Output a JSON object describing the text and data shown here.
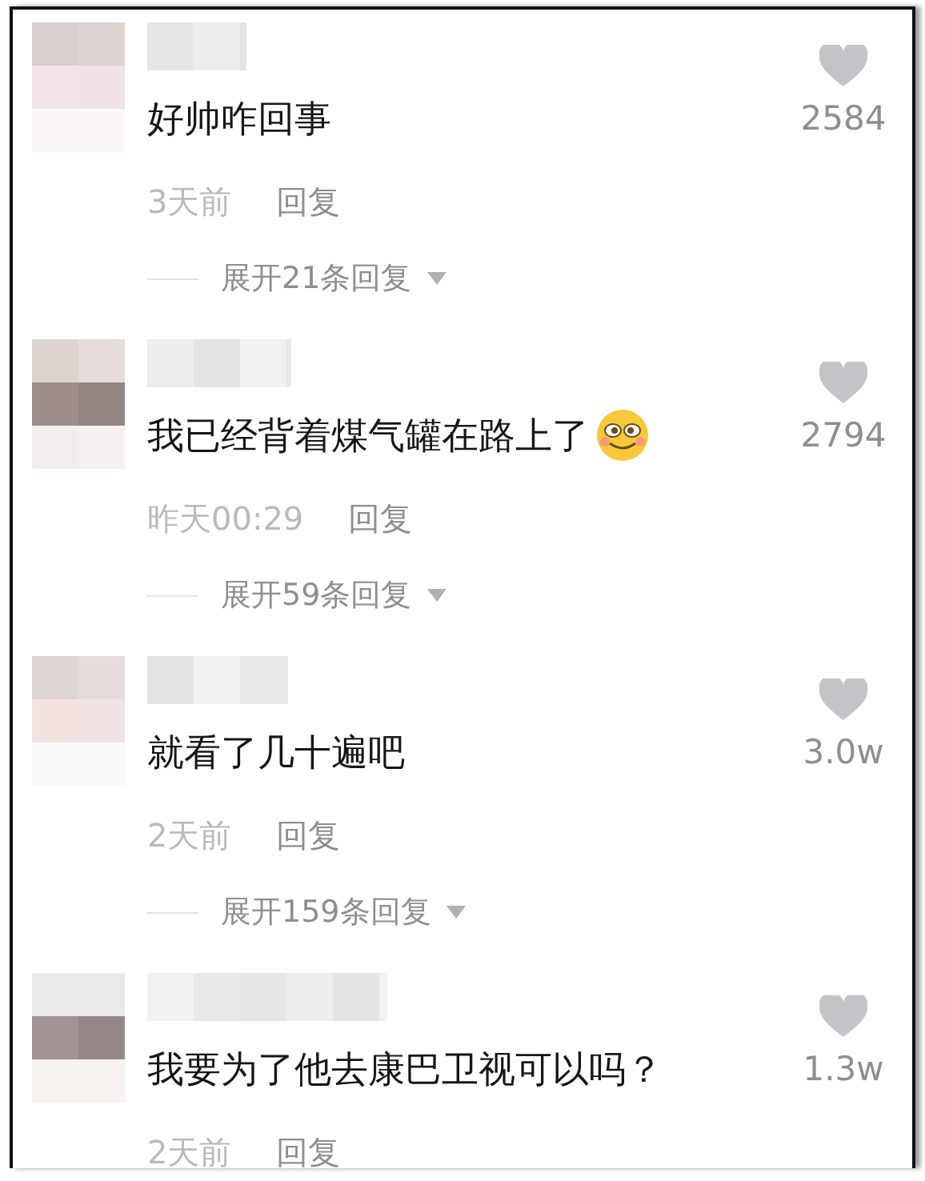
{
  "comments": [
    {
      "text": "好帅咋回事",
      "time": "3天前",
      "reply": "回复",
      "likes": "2584",
      "expand": "展开21条回复"
    },
    {
      "text": "我已经背着煤气罐在路上了",
      "emoji": true,
      "time": "昨天00:29",
      "reply": "回复",
      "likes": "2794",
      "expand": "展开59条回复"
    },
    {
      "text": "就看了几十遍吧",
      "time": "2天前",
      "reply": "回复",
      "likes": "3.0w",
      "expand": "展开159条回复"
    },
    {
      "text": "我要为了他去康巴卫视可以吗？",
      "time": "2天前",
      "reply": "回复",
      "likes": "1.3w"
    }
  ]
}
